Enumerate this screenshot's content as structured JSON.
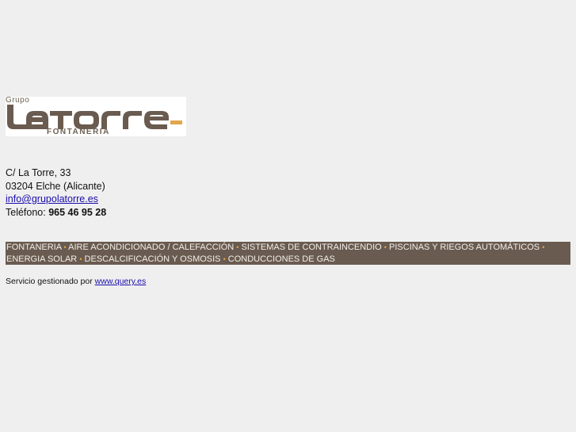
{
  "logo": {
    "small_text": "Grupo",
    "brand": "LATORRE",
    "sub_text": "FONTANERIA"
  },
  "address": {
    "street": "C/ La Torre, 33",
    "city": "03204 Elche (Alicante)",
    "email": "info@grupolatorre.es",
    "phone_label": "Teléfono:",
    "phone_value": "965 46 95 28"
  },
  "services": {
    "items": [
      "FONTANERIA",
      "AIRE ACONDICIONADO / CALEFACCIÓN",
      "SISTEMAS DE CONTRAINCENDIO",
      "PISCINAS Y RIEGOS AUTOMÁTICOS",
      "ENERGIA SOLAR",
      "DESCALCIFICACIÓN Y OSMOSIS",
      "CONDUCCIONES DE GAS"
    ],
    "separator": "•"
  },
  "credits": {
    "text": "Servicio gestionado por",
    "link": "www.query.es"
  },
  "colors": {
    "background": "#efefef",
    "brand_brown": "#6a5b50",
    "accent_yellow": "#e2a64a",
    "link": "#1a0dab"
  }
}
